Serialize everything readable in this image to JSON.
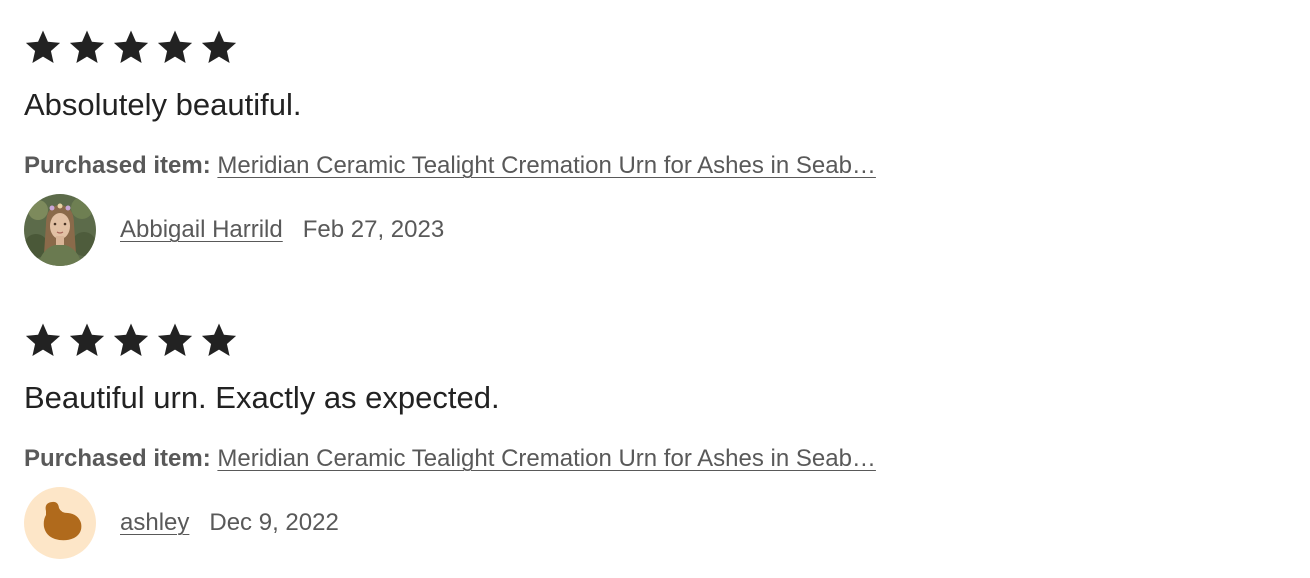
{
  "reviews": [
    {
      "rating": 5,
      "text": "Absolutely beautiful.",
      "purchased_label": "Purchased item:",
      "item_title": "Meridian Ceramic Tealight Cremation Urn for Ashes in Seab…",
      "reviewer": "Abbigail Harrild",
      "date": "Feb 27, 2023",
      "avatar": "photo-avatar"
    },
    {
      "rating": 5,
      "text": "Beautiful urn. Exactly as expected.",
      "purchased_label": "Purchased item:",
      "item_title": "Meridian Ceramic Tealight Cremation Urn for Ashes in Seab…",
      "reviewer": "ashley",
      "date": "Dec 9, 2022",
      "avatar": "default-blob-avatar"
    }
  ],
  "colors": {
    "star": "#222222",
    "secondary_text": "#595959",
    "default_avatar_bg": "#fde6c8",
    "default_avatar_shape": "#b06a1c"
  },
  "icons": {
    "star": "star-icon"
  }
}
